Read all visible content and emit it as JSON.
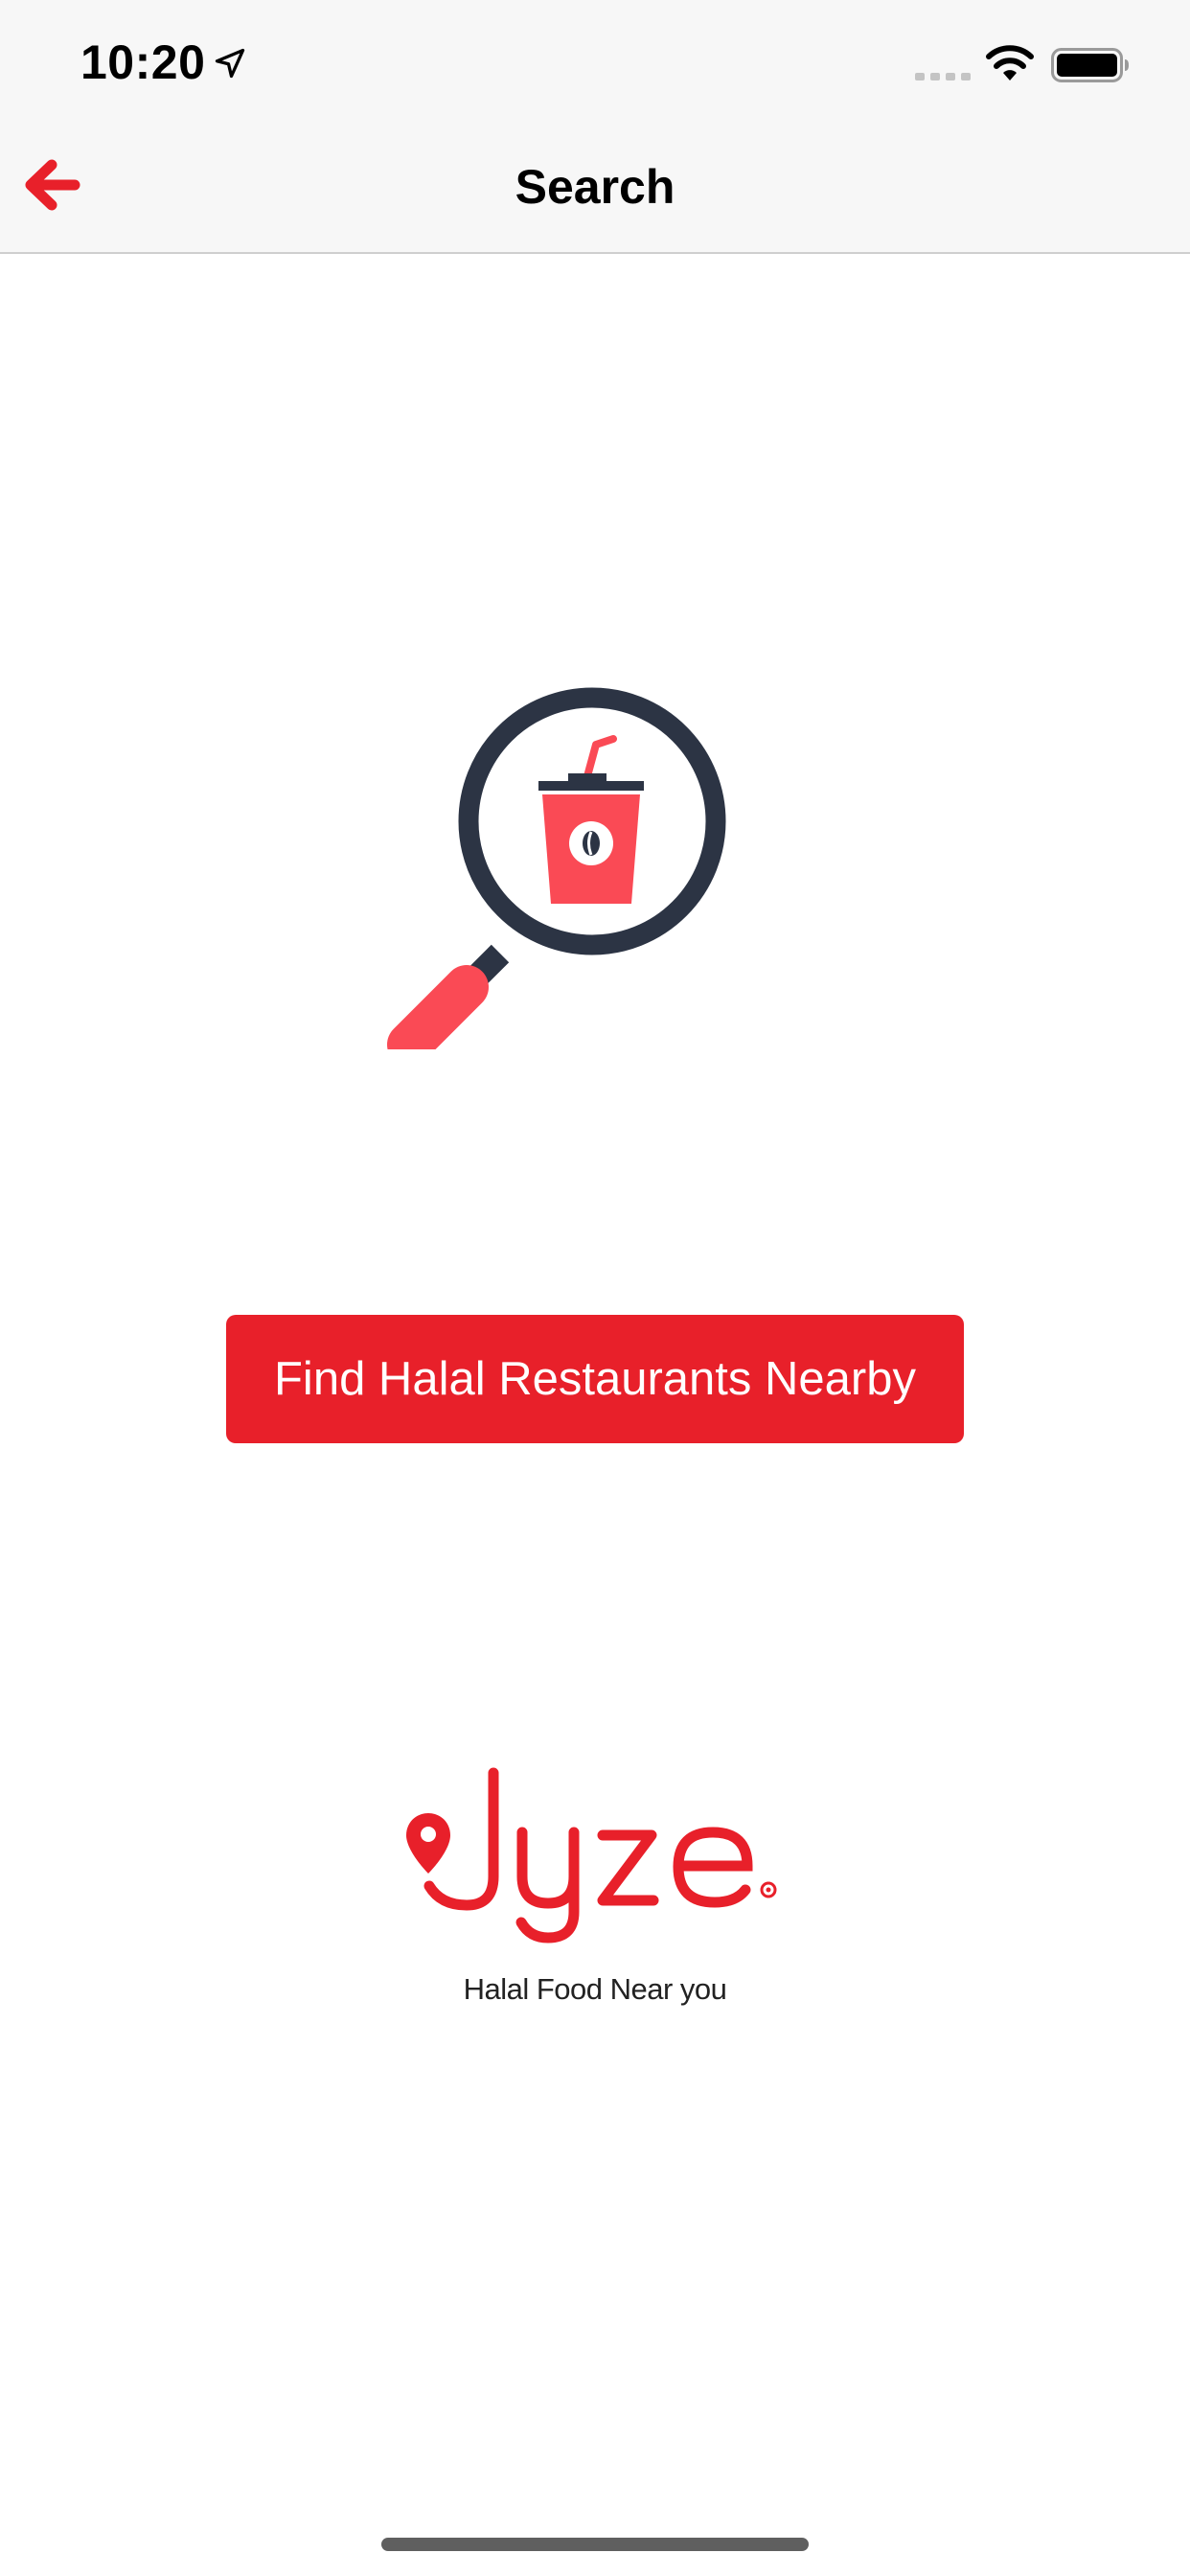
{
  "status_bar": {
    "time": "10:20",
    "icons": [
      "location-arrow-icon",
      "cellular-signal-icon",
      "wifi-icon",
      "battery-icon"
    ]
  },
  "nav": {
    "title": "Search",
    "back_icon": "back-arrow-icon"
  },
  "illustration": {
    "icon": "magnifier-drink-cup-icon"
  },
  "main": {
    "button_label": "Find Halal Restaurants Nearby"
  },
  "brand": {
    "logo_text": "Jyze",
    "tagline": "Halal Food Near you"
  },
  "colors": {
    "accent": "#e8202a",
    "illustration_red": "#fa4a55",
    "illustration_dark": "#2c3444",
    "bar_background": "#f7f7f7"
  }
}
